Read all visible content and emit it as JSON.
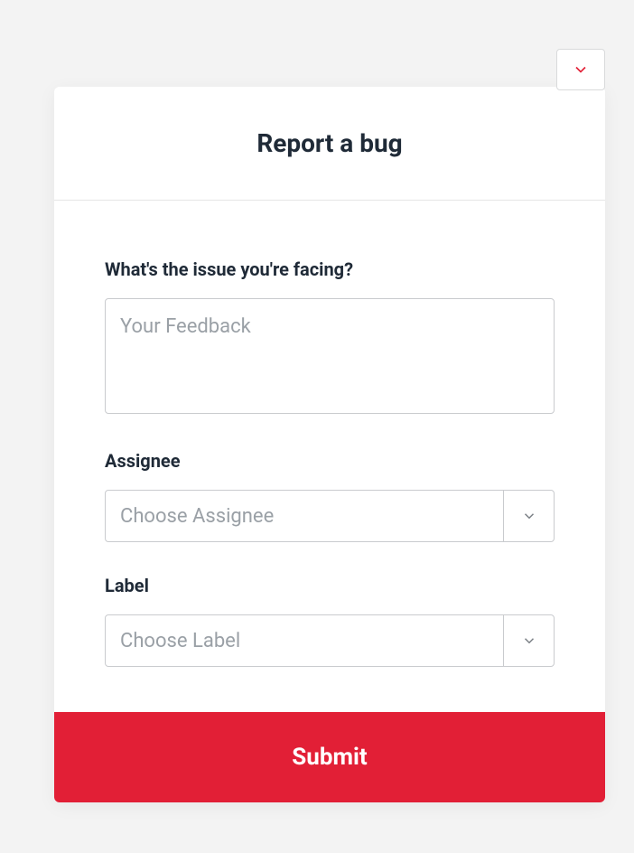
{
  "header": {
    "title": "Report a bug"
  },
  "form": {
    "issue": {
      "label": "What's the issue you're facing?",
      "placeholder": "Your Feedback",
      "value": ""
    },
    "assignee": {
      "label": "Assignee",
      "placeholder": "Choose Assignee"
    },
    "labelField": {
      "label": "Label",
      "placeholder": "Choose Label"
    },
    "submit": "Submit"
  },
  "colors": {
    "accent": "#e21f36"
  }
}
